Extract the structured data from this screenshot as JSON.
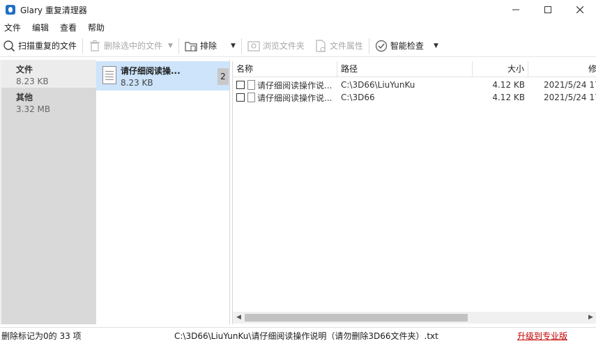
{
  "window": {
    "title": "Glary 重复清理器",
    "controls": [
      "minimize",
      "maximize",
      "close"
    ]
  },
  "menu": [
    "文件",
    "编辑",
    "查看",
    "帮助"
  ],
  "toolbar": {
    "scan_label": "扫描重复的文件",
    "delete_label": "删除选中的文件",
    "exclude_label": "排除",
    "browse_label": "浏览文件夹",
    "props_label": "文件属性",
    "smart_label": "智能检查"
  },
  "categories": [
    {
      "name": "文件",
      "size": "8.23 KB"
    },
    {
      "name": "其他",
      "size": "3.32 MB"
    }
  ],
  "groups": [
    {
      "name": "请仔细阅读操...",
      "size": "8.23 KB",
      "count": "2"
    }
  ],
  "file_list": {
    "columns": [
      "名称",
      "路径",
      "大小",
      "修"
    ],
    "rows": [
      {
        "name": "请仔细阅读操作说...",
        "path": "C:\\3D66\\LiuYunKu",
        "size": "4.12 KB",
        "modified": "2021/5/24 17"
      },
      {
        "name": "请仔细阅读操作说...",
        "path": "C:\\3D66",
        "size": "4.12 KB",
        "modified": "2021/5/24 17"
      }
    ]
  },
  "status": {
    "marked": "删除标记为0的 33 项",
    "path": "C:\\3D66\\LiuYunKu\\请仔细阅读操作说明（请勿删除3D66文件夹）.txt",
    "upgrade": "升级到专业版"
  },
  "colors": {
    "accent": "#1f6fc5",
    "selection": "#cde4fb",
    "upgrade": "#c00000"
  }
}
